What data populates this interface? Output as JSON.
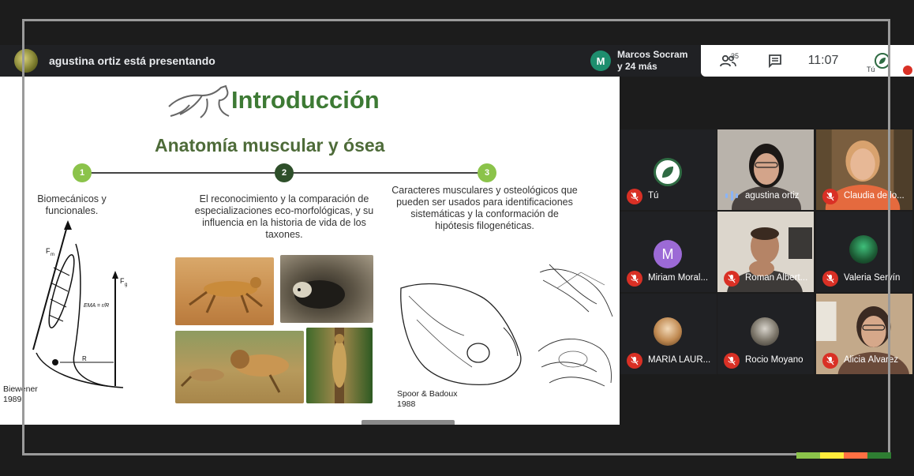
{
  "presenter": {
    "text": "agustina ortiz está presentando"
  },
  "others": {
    "avatar_initial": "M",
    "line1": "Marcos Socram",
    "line2": "y 24 más"
  },
  "controls": {
    "people_count": "35",
    "time": "11:07",
    "me_label": "Tú"
  },
  "slide": {
    "title": "Introducción",
    "subtitle": "Anatomía muscular y ósea",
    "steps": [
      "1",
      "2",
      "3"
    ],
    "col1": "Biomecánicos y funcionales.",
    "col2": "El reconocimiento y la comparación de especializaciones eco-morfológicas, y su influencia en la historia de vida de los taxones.",
    "col3": "Caracteres musculares y osteológicos que pueden ser usados para identificaciones sistemáticas y la conformación de hipótesis filogenéticas.",
    "cite1": "Biewener 1989",
    "cite2": "Spoor & Badoux 1988",
    "diagram_labels": {
      "fm": "F",
      "fm_sub": "m",
      "ema": "EMA = r/R",
      "r": "R",
      "fg": "F",
      "fg_sub": "g"
    }
  },
  "participants": [
    {
      "name": "Tú",
      "muted": true
    },
    {
      "name": "agustina ortiz",
      "muted": false
    },
    {
      "name": "Claudia de lo...",
      "muted": true
    },
    {
      "name": "Miriam Moral...",
      "muted": true,
      "initial": "M"
    },
    {
      "name": "Roman Albert...",
      "muted": true
    },
    {
      "name": "Valeria Servín",
      "muted": true
    },
    {
      "name": "MARIA LAUR...",
      "muted": true
    },
    {
      "name": "Rocio Moyano",
      "muted": true
    },
    {
      "name": "Alicia Álvarez",
      "muted": true
    }
  ],
  "colors": {
    "accent_green": "#3d7a34",
    "mute_red": "#d93025",
    "miriam_avatar": "#9c6ad6",
    "bar": [
      "#8bc34a",
      "#ffeb3b",
      "#ff7043",
      "#2e7d32"
    ]
  },
  "icons": {
    "people": "people-icon",
    "chat": "chat-icon",
    "mic_off": "mic-off-icon",
    "speaking": "speaking-icon"
  }
}
